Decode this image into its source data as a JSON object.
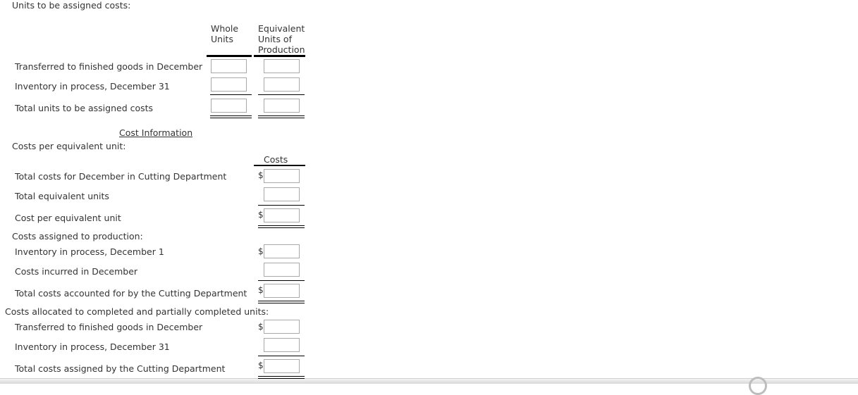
{
  "units_section": {
    "title": "Units to be assigned costs:",
    "col_whole": [
      "Whole",
      "Units"
    ],
    "col_equiv": [
      "Equivalent",
      "Units of",
      "Production"
    ],
    "rows": [
      {
        "label": "Transferred to finished goods in December",
        "whole": "",
        "equiv": ""
      },
      {
        "label": "Inventory in process, December 31",
        "whole": "",
        "equiv": ""
      },
      {
        "label": "Total units to be assigned costs",
        "whole": "",
        "equiv": ""
      }
    ]
  },
  "cost_info": {
    "heading": "Cost Information",
    "per_unit_title": "Costs per equivalent unit:",
    "costs_col": "Costs",
    "per_unit_rows": [
      {
        "label": "Total costs for December in Cutting Department",
        "currency": "$",
        "value": ""
      },
      {
        "label": "Total equivalent units",
        "currency": "",
        "value": ""
      },
      {
        "label": "Cost per equivalent unit",
        "currency": "$",
        "value": ""
      }
    ],
    "assigned_title": "Costs assigned to production:",
    "assigned_rows": [
      {
        "label": "Inventory in process, December 1",
        "currency": "$",
        "value": ""
      },
      {
        "label": "Costs incurred in December",
        "currency": "",
        "value": ""
      },
      {
        "label": "Total costs accounted for by the Cutting Department",
        "currency": "$",
        "value": ""
      }
    ],
    "allocated_title": "Costs allocated to completed and partially completed units:",
    "allocated_rows": [
      {
        "label": "Transferred to finished goods in December",
        "currency": "$",
        "value": ""
      },
      {
        "label": "Inventory in process, December 31",
        "currency": "",
        "value": ""
      },
      {
        "label": "Total costs assigned by the Cutting Department",
        "currency": "$",
        "value": ""
      }
    ]
  }
}
